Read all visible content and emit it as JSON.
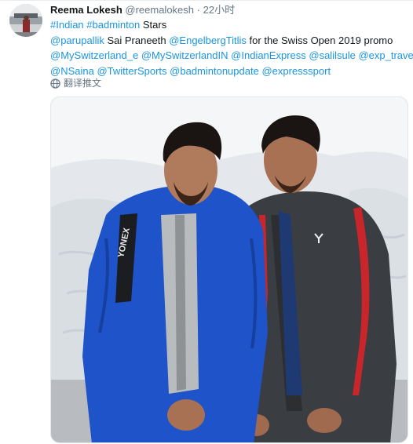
{
  "tweet": {
    "author": {
      "display_name": "Reema Lokesh",
      "handle": "@reemalokesh",
      "avatar_icon": "user-avatar"
    },
    "separator": "·",
    "time": "22小时",
    "lines": [
      [
        {
          "text": "#Indian",
          "type": "link"
        },
        {
          "text": " ",
          "type": "text"
        },
        {
          "text": "#badminton",
          "type": "link"
        },
        {
          "text": " Stars",
          "type": "text"
        }
      ],
      [
        {
          "text": "@parupallik",
          "type": "link"
        },
        {
          "text": " Sai Praneeth ",
          "type": "text"
        },
        {
          "text": "@EngelbergTitlis",
          "type": "link"
        },
        {
          "text": " for the Swiss Open 2019 promo",
          "type": "text"
        }
      ],
      [
        {
          "text": "@MySwitzerland_e",
          "type": "link"
        },
        {
          "text": " ",
          "type": "text"
        },
        {
          "text": "@MySwitzerlandIN",
          "type": "link"
        },
        {
          "text": " ",
          "type": "text"
        },
        {
          "text": "@IndianExpress",
          "type": "link"
        },
        {
          "text": " ",
          "type": "text"
        },
        {
          "text": "@salilsule",
          "type": "link"
        },
        {
          "text": " ",
          "type": "text"
        },
        {
          "text": "@exp_travel",
          "type": "link"
        }
      ],
      [
        {
          "text": "@NSaina",
          "type": "link"
        },
        {
          "text": " ",
          "type": "text"
        },
        {
          "text": "@TwitterSports",
          "type": "link"
        },
        {
          "text": " ",
          "type": "text"
        },
        {
          "text": "@badmintonupdate",
          "type": "link"
        },
        {
          "text": " ",
          "type": "text"
        },
        {
          "text": "@expresssport",
          "type": "link"
        }
      ]
    ],
    "translate_label": "翻译推文",
    "translate_icon": "globe-icon",
    "media": {
      "jacket_brand": "YONEX",
      "colors": {
        "sky": "#f4f6f8",
        "snow": "#e6eaee",
        "left_jacket": "#1f53c9",
        "right_jacket": "#3a3d42",
        "stripe": "#c9262c",
        "skin": "#a87154",
        "hair": "#1a1412"
      }
    },
    "colors": {
      "link": "#1b95e0",
      "secondary": "#657786",
      "text": "#14171a",
      "border": "#e6ecf0"
    }
  }
}
